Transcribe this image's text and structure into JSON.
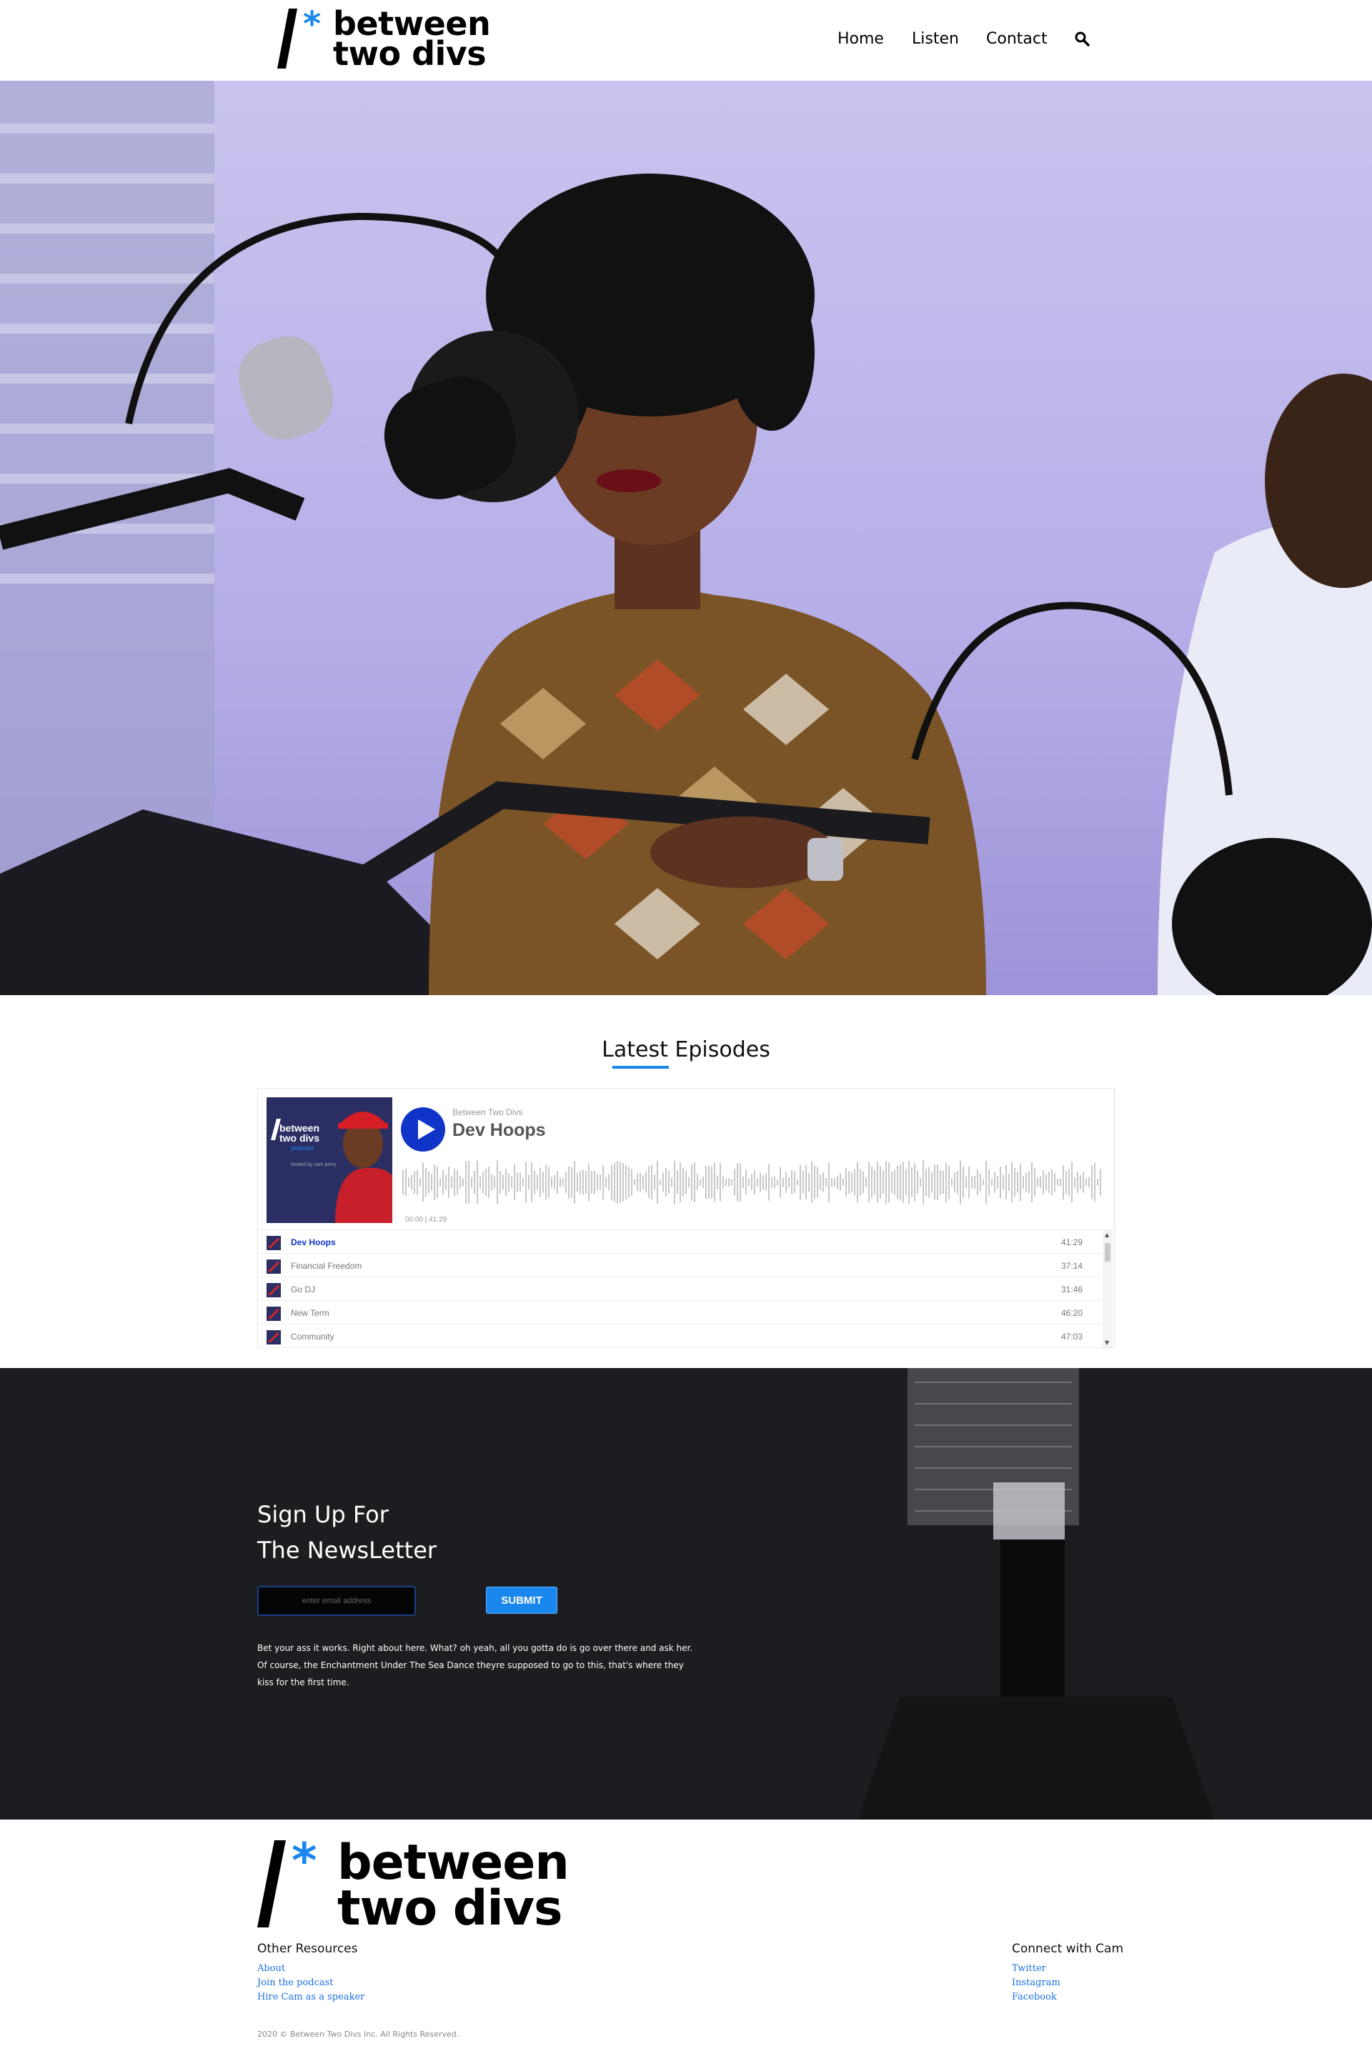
{
  "header": {
    "logo_line1": "between",
    "logo_line2": "two divs",
    "nav": {
      "home": "Home",
      "listen": "Listen",
      "contact": "Contact"
    }
  },
  "episodes": {
    "title": "Latest Episodes",
    "player": {
      "show": "Between Two Divs",
      "current_episode": "Dev Hoops",
      "time": "00:00  |  41:29",
      "cover": {
        "title_line1": "between",
        "title_line2": "two divs",
        "subtitle": "podcast",
        "host": "hosted by\ncam perry"
      },
      "tracks": [
        {
          "name": "Dev Hoops",
          "duration": "41:29",
          "active": true
        },
        {
          "name": "Financial Freedom",
          "duration": "37:14",
          "active": false
        },
        {
          "name": "Go DJ",
          "duration": "31:46",
          "active": false
        },
        {
          "name": "New Term",
          "duration": "46:20",
          "active": false
        },
        {
          "name": "Community",
          "duration": "47:03",
          "active": false
        }
      ]
    }
  },
  "newsletter": {
    "title_line1": "Sign Up For",
    "title_line2": "The NewsLetter",
    "email_placeholder": "enter email address",
    "submit_label": "SUBMIT",
    "copy": "Bet your ass it works. Right about here. What? oh yeah, all you gotta do is go over there and ask her. Of course, the Enchantment Under The Sea Dance theyre supposed to go to this, that's where they kiss for the first time."
  },
  "footer": {
    "logo_line1": "between",
    "logo_line2": "two divs",
    "other_resources": {
      "title": "Other Resources",
      "links": [
        "About",
        "Join the podcast",
        "Hire Cam as a speaker"
      ]
    },
    "connect": {
      "title": "Connect with Cam",
      "links": [
        "Twitter",
        "Instagram",
        "Facebook"
      ]
    },
    "copyright": "2020 © Between Two Divs Inc. All Rights Reserved."
  },
  "colors": {
    "accent": "#1a87ee",
    "player_blue": "#1134c8",
    "dark_section": "#1c1d20"
  }
}
